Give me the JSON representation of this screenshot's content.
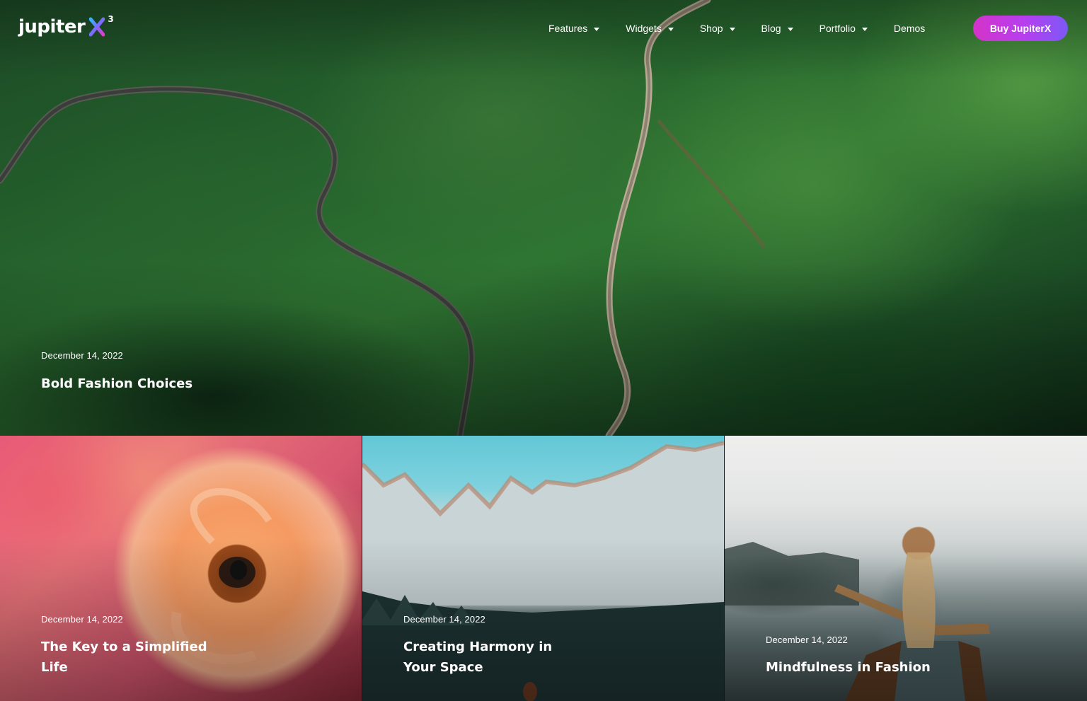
{
  "brand": {
    "logo_text": "jupiter",
    "logo_mark": "X",
    "logo_version": "3",
    "accent_gradient": [
      "#d433c8",
      "#b63ff0",
      "#7c58f5"
    ]
  },
  "nav": {
    "items": [
      {
        "label": "Features",
        "has_dropdown": true
      },
      {
        "label": "Widgets",
        "has_dropdown": true
      },
      {
        "label": "Shop",
        "has_dropdown": true
      },
      {
        "label": "Blog",
        "has_dropdown": true
      },
      {
        "label": "Portfolio",
        "has_dropdown": true
      },
      {
        "label": "Demos",
        "has_dropdown": false
      }
    ],
    "cta_label": "Buy JupiterX"
  },
  "hero": {
    "date": "December 14, 2022",
    "title": "Bold Fashion Choices"
  },
  "posts": [
    {
      "date": "December 14, 2022",
      "title": "The Key to a Simplified Life"
    },
    {
      "date": "December 14, 2022",
      "title": "Creating Harmony in Your Space"
    },
    {
      "date": "December 14, 2022",
      "title": "Mindfulness in Fashion"
    }
  ]
}
